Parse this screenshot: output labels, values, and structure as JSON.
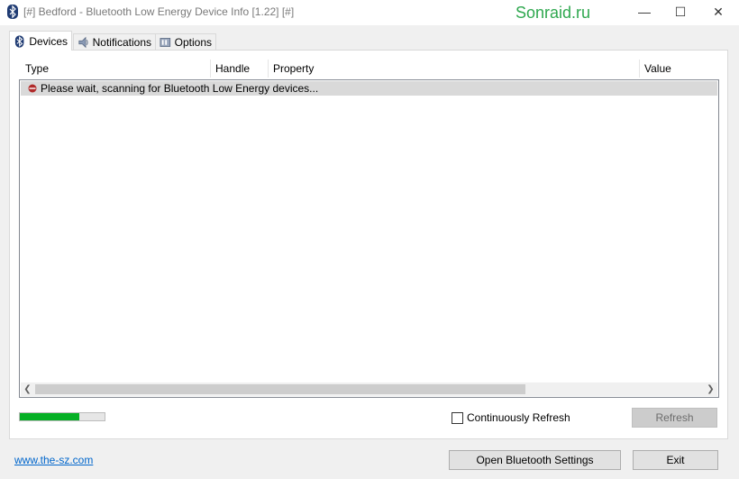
{
  "window": {
    "title": "[#] Bedford - Bluetooth Low Energy Device Info [1.22] [#]",
    "watermark": "Sonraid.ru",
    "controls": {
      "minimize": "—",
      "maximize": "☐",
      "close": "✕"
    }
  },
  "tabs": [
    {
      "label": "Devices",
      "icon": "bluetooth-icon",
      "active": true
    },
    {
      "label": "Notifications",
      "icon": "notification-icon",
      "active": false
    },
    {
      "label": "Options",
      "icon": "options-icon",
      "active": false
    }
  ],
  "list": {
    "columns": [
      "Type",
      "Handle",
      "Property",
      "Value"
    ],
    "rows": [
      {
        "text": "Please wait, scanning for Bluetooth Low Energy devices...",
        "icon": "scanning-icon"
      }
    ]
  },
  "progress": {
    "value": 0.7
  },
  "continuous_refresh": {
    "label": "Continuously Refresh",
    "checked": false
  },
  "buttons": {
    "refresh": "Refresh",
    "open_bt_settings": "Open Bluetooth Settings",
    "exit": "Exit"
  },
  "footer": {
    "link": "www.the-sz.com"
  },
  "colors": {
    "progress": "#06b025",
    "link": "#0066cc",
    "watermark": "#2fa84f"
  }
}
